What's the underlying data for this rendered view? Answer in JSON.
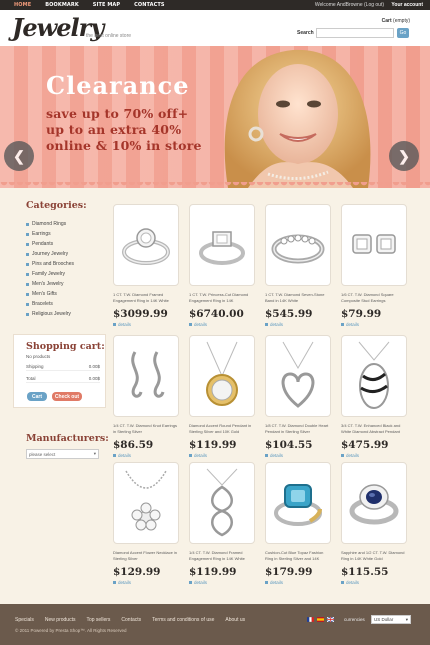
{
  "topbar": {
    "nav": [
      "HOME",
      "BOOKMARK",
      "SITE MAP",
      "CONTACTS"
    ],
    "welcome": "Welcome AndBrowne",
    "login": "Log out",
    "account": "Your account"
  },
  "header": {
    "logo": "Jewelry",
    "tagline": "the best online store",
    "cart_label": "Cart",
    "cart_status": "(empty)",
    "search_label": "Search",
    "search_button": "Go"
  },
  "banner": {
    "title": "Clearance",
    "lines": [
      "save up to 70% off+",
      "up to an extra 40%",
      "online & 10% in store"
    ]
  },
  "sidebar": {
    "categories_heading": "Categories:",
    "categories": [
      "Diamond Rings",
      "Earrings",
      "Pendants",
      "Journey Jewelry",
      "Pins and Brooches",
      "Family Jewelry",
      "Men's Jewelry",
      "Men's Gifts",
      "Bracelets",
      "Religious Jewelry"
    ],
    "cart_heading": "Shopping cart:",
    "no_products": "No products",
    "shipping_label": "Shipping",
    "shipping_value": "0.00$",
    "total_label": "Total",
    "total_value": "0.00$",
    "cart_button": "Cart",
    "checkout_button": "Check out",
    "manufacturers_heading": "Manufacturers:",
    "manufacturers_select": "please select"
  },
  "products": [
    {
      "name": "1 CT. T.W. Diamond Framed Engagement Ring in 14K White",
      "price": "$3099.99",
      "details": "details"
    },
    {
      "name": "1 CT. T.W. Princess-Cut Diamond Engagement Ring in 14K",
      "price": "$6740.00",
      "details": "details"
    },
    {
      "name": "1 CT. T.W. Diamond Seven-Stone Band in 14K White",
      "price": "$545.99",
      "details": "details"
    },
    {
      "name": "1/6 CT. T.W. Diamond Square Composite Stud Earrings",
      "price": "$79.99",
      "details": "details"
    },
    {
      "name": "1/4 CT. T.W. Diamond Knot Earrings in Sterling Silver",
      "price": "$86.59",
      "details": "details"
    },
    {
      "name": "Diamond Accent Round Pendant in Sterling Silver and 10K Gold",
      "price": "$119.99",
      "details": "details"
    },
    {
      "name": "1/8 CT. T.W. Diamond Double Heart Pendant in Sterling Silver",
      "price": "$104.55",
      "details": "details"
    },
    {
      "name": "3/4 CT. T.W. Enhanced Black and White Diamond Abstract Pendant",
      "price": "$475.99",
      "details": "details"
    },
    {
      "name": "Diamond Accent Flower Necklace in Sterling Silver",
      "price": "$129.99",
      "details": "details"
    },
    {
      "name": "1/4 CT. T.W. Diamond Framed Engagement Ring in 14K White",
      "price": "$119.99",
      "details": "details"
    },
    {
      "name": "Cushion-Cut Blue Topaz Fashion Ring in Sterling Silver and 14K",
      "price": "$179.99",
      "details": "details"
    },
    {
      "name": "Sapphire and 1/2 CT. T.W. Diamond Ring in 14K White Gold",
      "price": "$115.55",
      "details": "details"
    }
  ],
  "footer": {
    "links": [
      "Specials",
      "New products",
      "Top sellers",
      "Contacts",
      "Terms and conditions of use",
      "About us"
    ],
    "copyright": "© 2011 Powered by Presta Shop™. All Rights Reserved",
    "currencies_label": "currencies",
    "currency": "US Dollar"
  },
  "colors": {
    "accent_blue": "#6aa2c6",
    "heading_brown": "#8a4236",
    "banner_pink": "#f5b3a6",
    "footer_brown": "#6b5a4c"
  }
}
